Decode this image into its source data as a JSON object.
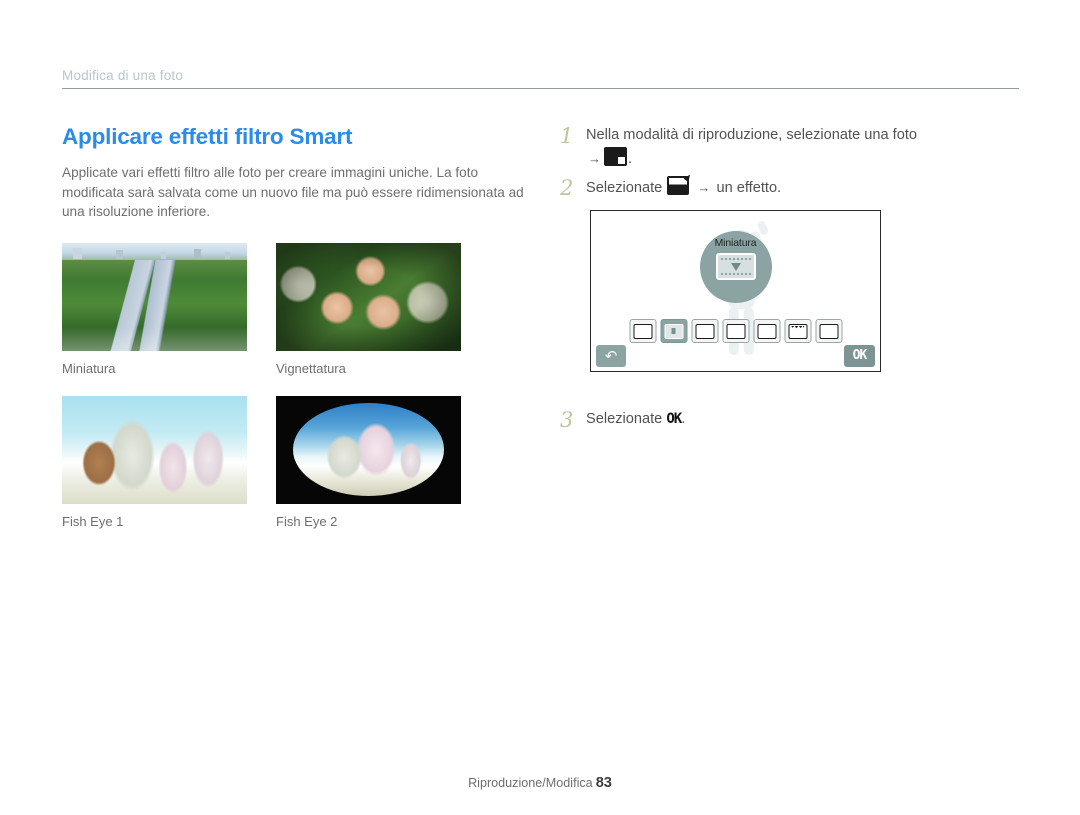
{
  "header": {
    "chapter": "Modifica di una foto"
  },
  "section": {
    "title": "Applicare effetti filtro Smart",
    "intro": "Applicate vari effetti filtro alle foto per creare immagini uniche. La foto modificata sarà salvata come un nuovo file ma può essere ridimensionata ad una risoluzione inferiore."
  },
  "samples": [
    {
      "caption": "Miniatura",
      "icon": "thumbnail-miniature-sample"
    },
    {
      "caption": "Vignettatura",
      "icon": "thumbnail-vignette-sample"
    },
    {
      "caption": "Fish Eye 1",
      "icon": "thumbnail-fisheye1-sample"
    },
    {
      "caption": "Fish Eye 2",
      "icon": "thumbnail-fisheye2-sample"
    }
  ],
  "steps": [
    {
      "num": "1",
      "text": "Nella modalità di riproduzione, selezionate una foto",
      "sub_arrow": "→",
      "sub_suffix": "."
    },
    {
      "num": "2",
      "prefix": "Selezionate",
      "arrow": "→",
      "suffix": "un effetto."
    },
    {
      "num": "3",
      "prefix": "Selezionate",
      "ok": "OK",
      "suffix": "."
    }
  ],
  "screen": {
    "badge_label": "Miniatura",
    "back_glyph": "�averted",
    "ok_label": "OK",
    "filters": [
      {
        "name": "smart-filter-icon"
      },
      {
        "name": "miniature-filter-icon",
        "selected": true
      },
      {
        "name": "vignette-filter-icon"
      },
      {
        "name": "halftone-dot-filter-icon"
      },
      {
        "name": "sketch-filter-icon"
      },
      {
        "name": "fisheye-filter-icon"
      },
      {
        "name": "classic-frame-filter-icon"
      }
    ]
  },
  "footer": {
    "label": "Riproduzione/Modifica",
    "page": "83"
  },
  "colors": {
    "title_blue": "#2b8bea",
    "chapter_gray": "#b9c6cc",
    "step_number_green": "#b9c79a",
    "ui_teal": "#8ba3a3"
  }
}
